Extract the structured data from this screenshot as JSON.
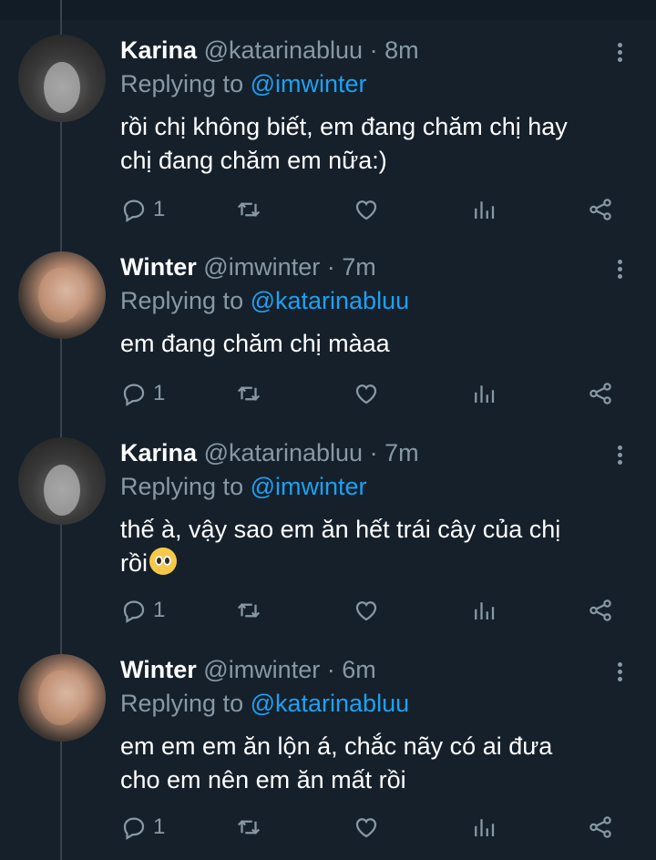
{
  "tweets": [
    {
      "name": "Karina",
      "handle": "@katarinabluu",
      "time": "8m",
      "replying_prefix": "Replying to ",
      "replying_to": "@imwinter",
      "lines": [
        "rồi chị không biết, em đang chăm chị hay",
        "chị đang chăm em nữa:)"
      ],
      "reply_count": "1",
      "avatar": "karina"
    },
    {
      "name": "Winter",
      "handle": "@imwinter",
      "time": "7m",
      "replying_prefix": "Replying to ",
      "replying_to": "@katarinabluu",
      "lines": [
        "em đang chăm chị màaa"
      ],
      "reply_count": "1",
      "avatar": "winter"
    },
    {
      "name": "Karina",
      "handle": "@katarinabluu",
      "time": "7m",
      "replying_prefix": "Replying to ",
      "replying_to": "@imwinter",
      "lines": [
        "thế à, vậy sao em ăn hết trái cây của chị",
        "rồi"
      ],
      "emoji": "pleading-face",
      "reply_count": "1",
      "avatar": "karina"
    },
    {
      "name": "Winter",
      "handle": "@imwinter",
      "time": "6m",
      "replying_prefix": "Replying to ",
      "replying_to": "@katarinabluu",
      "lines": [
        "em em em ăn lộn á, chắc nãy có ai đưa",
        "cho em nên em ăn mất rồi"
      ],
      "reply_count": "1",
      "avatar": "winter"
    }
  ],
  "separator": "·",
  "colors": {
    "background": "#15202b",
    "secondary": "#8899a6",
    "accent": "#1da1f2",
    "thread_line": "#38444d"
  },
  "icons": [
    "reply-icon",
    "retweet-icon",
    "like-icon",
    "analytics-icon",
    "share-icon",
    "more-icon"
  ]
}
